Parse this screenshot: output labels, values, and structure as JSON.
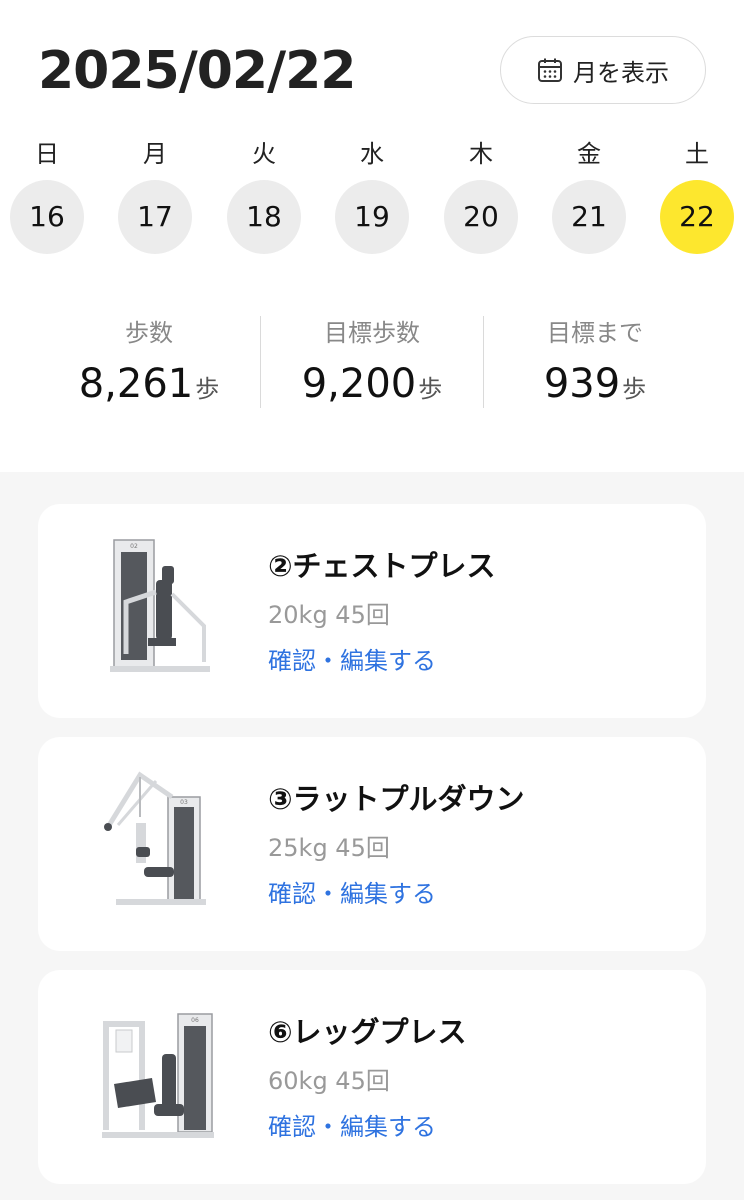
{
  "header": {
    "date": "2025/02/22",
    "month_button_label": "月を表示",
    "month_button_icon": "calendar-icon"
  },
  "week": {
    "days": [
      {
        "dow": "日",
        "num": "16"
      },
      {
        "dow": "月",
        "num": "17"
      },
      {
        "dow": "火",
        "num": "18"
      },
      {
        "dow": "水",
        "num": "19"
      },
      {
        "dow": "木",
        "num": "20"
      },
      {
        "dow": "金",
        "num": "21"
      },
      {
        "dow": "土",
        "num": "22"
      }
    ],
    "selected_index": 6,
    "selected_color": "#fde72e"
  },
  "stats": [
    {
      "label": "歩数",
      "value": "8,261",
      "unit": "歩"
    },
    {
      "label": "目標歩数",
      "value": "9,200",
      "unit": "歩"
    },
    {
      "label": "目標まで",
      "value": "939",
      "unit": "歩"
    }
  ],
  "exercises": [
    {
      "title": "②チェストプレス",
      "detail": "20kg 45回",
      "action": "確認・編集する",
      "image": "chest-press-machine-image"
    },
    {
      "title": "③ラットプルダウン",
      "detail": "25kg 45回",
      "action": "確認・編集する",
      "image": "lat-pulldown-machine-image"
    },
    {
      "title": "⑥レッグプレス",
      "detail": "60kg 45回",
      "action": "確認・編集する",
      "image": "leg-press-machine-image"
    }
  ],
  "colors": {
    "accent_yellow": "#fde72e",
    "link_blue": "#2f73e0",
    "background": "#f6f6f6"
  }
}
